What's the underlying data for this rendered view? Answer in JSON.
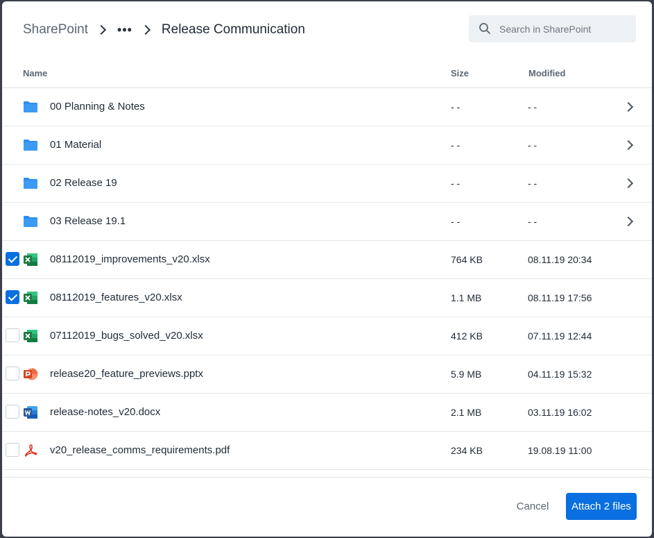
{
  "header": {
    "breadcrumb_root": "SharePoint",
    "breadcrumb_ellipsis": "•••",
    "breadcrumb_current": "Release Communication"
  },
  "search": {
    "placeholder": "Search in SharePoint"
  },
  "columns": {
    "name": "Name",
    "size": "Size",
    "modified": "Modified"
  },
  "files": [
    {
      "name": "00 Planning & Notes",
      "size": "- -",
      "modified": "- -",
      "type": "folder",
      "icon": "folder-icon"
    },
    {
      "name": "01 Material",
      "size": "- -",
      "modified": "- -",
      "type": "folder",
      "icon": "folder-icon"
    },
    {
      "name": "02 Release 19",
      "size": "- -",
      "modified": "- -",
      "type": "folder",
      "icon": "folder-icon"
    },
    {
      "name": "03 Release 19.1",
      "size": "- -",
      "modified": "- -",
      "type": "folder",
      "icon": "folder-icon"
    },
    {
      "name": "08112019_improvements_v20.xlsx",
      "size": "764 KB",
      "modified": "08.11.19 20:34",
      "type": "xlsx",
      "icon": "excel-icon",
      "checked": true
    },
    {
      "name": "08112019_features_v20.xlsx",
      "size": "1.1 MB",
      "modified": "08.11.19 17:56",
      "type": "xlsx",
      "icon": "excel-icon",
      "checked": true
    },
    {
      "name": "07112019_bugs_solved_v20.xlsx",
      "size": "412 KB",
      "modified": "07.11.19 12:44",
      "type": "xlsx",
      "icon": "excel-icon",
      "checked": false
    },
    {
      "name": "release20_feature_previews.pptx",
      "size": "5.9 MB",
      "modified": "04.11.19 15:32",
      "type": "pptx",
      "icon": "powerpoint-icon",
      "checked": false
    },
    {
      "name": "release-notes_v20.docx",
      "size": "2.1 MB",
      "modified": "03.11.19 16:02",
      "type": "docx",
      "icon": "word-icon",
      "checked": false
    },
    {
      "name": "v20_release_comms_requirements.pdf",
      "size": "234 KB",
      "modified": "19.08.19 11:00",
      "type": "pdf",
      "icon": "pdf-icon",
      "checked": false
    }
  ],
  "footer": {
    "cancel_label": "Cancel",
    "attach_label": "Attach 2 files"
  },
  "colors": {
    "accent": "#0a6fe0",
    "folder": "#2b8ef0",
    "excel": "#1e7a45",
    "powerpoint": "#d24726",
    "word": "#2b579a",
    "pdf": "#e0301e"
  }
}
